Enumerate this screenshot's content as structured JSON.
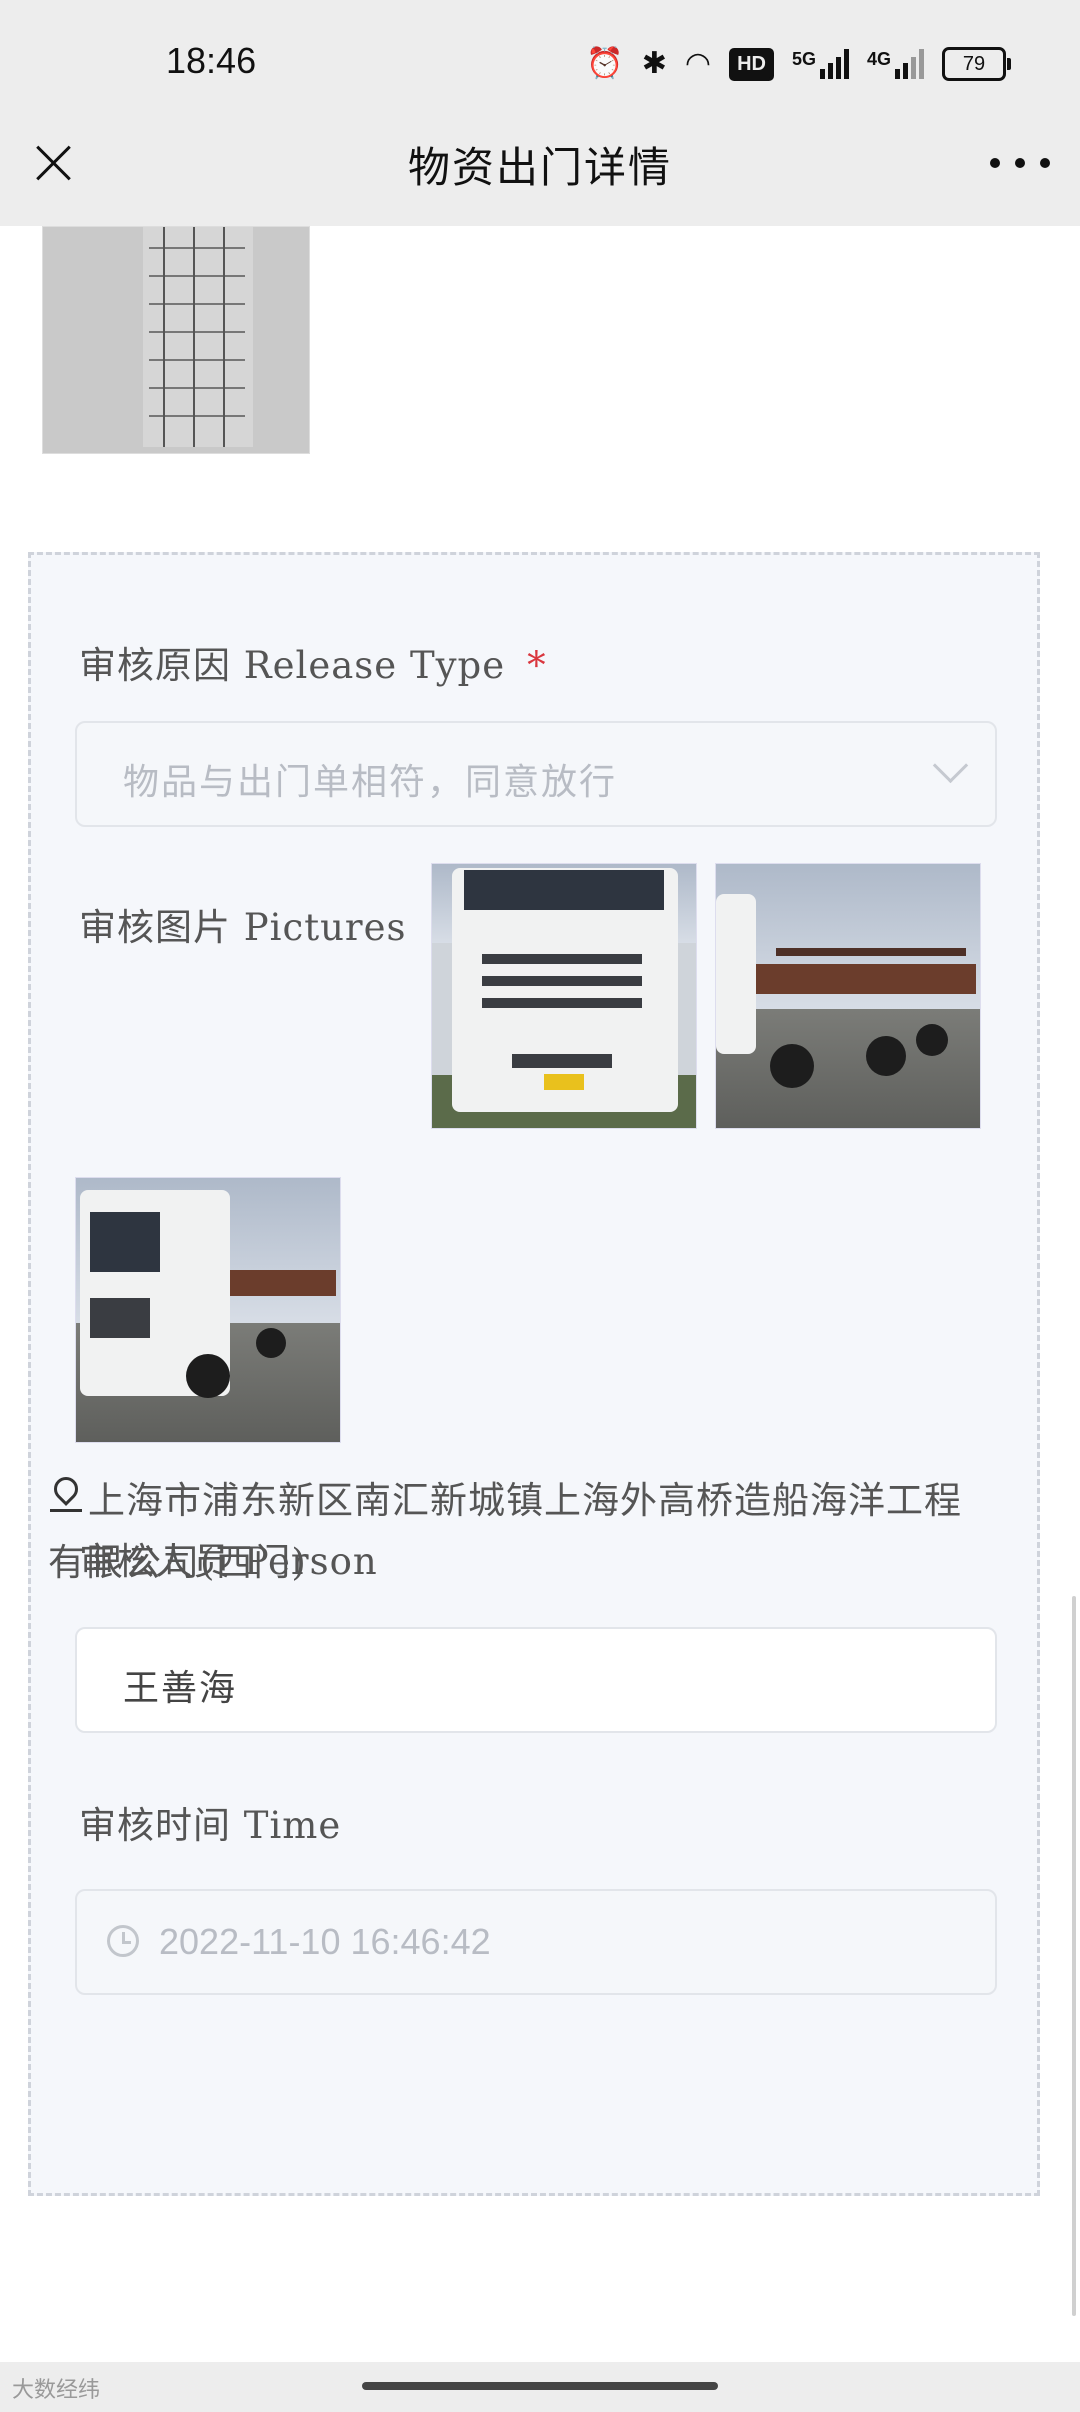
{
  "status_bar": {
    "time": "18:46",
    "icons": [
      "alarm-icon",
      "bluetooth-icon",
      "wifi-icon",
      "hd-icon",
      "signal-5g-icon",
      "signal-4g-icon",
      "battery-icon"
    ],
    "hd_label": "HD",
    "net1_label": "5G",
    "net2_label": "4G",
    "battery_level": "79"
  },
  "nav": {
    "title": "物资出门详情"
  },
  "review": {
    "release_type_label": "审核原因 Release Type",
    "required_mark": "*",
    "release_type_value": "物品与出门单相符，同意放行",
    "pictures_label": "审核图片 Pictures",
    "photos": [
      "truck-front-photo",
      "truck-side-photo",
      "truck-angle-photo"
    ],
    "person_label": "审核人员 Person",
    "person_value": "王善海",
    "time_label": "审核时间 Time",
    "time_value": "2022-11-10 16:46:42",
    "address": "上海市浦东新区南汇新城镇上海外高桥造船海洋工程有限公司(西门)"
  },
  "watermark": "大数经纬"
}
